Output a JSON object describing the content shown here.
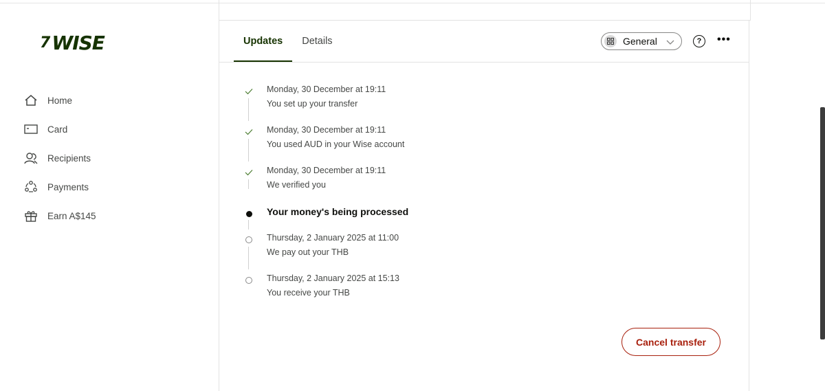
{
  "brand": {
    "mark": "7",
    "name": "WISE"
  },
  "sidebar": {
    "items": [
      {
        "label": "Home",
        "icon": "home-icon"
      },
      {
        "label": "Card",
        "icon": "card-icon"
      },
      {
        "label": "Recipients",
        "icon": "recipients-icon"
      },
      {
        "label": "Payments",
        "icon": "payments-icon"
      },
      {
        "label": "Earn A$145",
        "icon": "gift-icon"
      }
    ]
  },
  "tabs": [
    {
      "label": "Updates",
      "active": true
    },
    {
      "label": "Details",
      "active": false
    }
  ],
  "toolbar": {
    "account_selector": "General",
    "help_glyph": "?",
    "more_glyph": "•••"
  },
  "timeline": [
    {
      "status": "done",
      "date": "Monday, 30 December at 19:11",
      "text": "You set up your transfer"
    },
    {
      "status": "done",
      "date": "Monday, 30 December at 19:11",
      "text": "You used AUD in your Wise account"
    },
    {
      "status": "done",
      "date": "Monday, 30 December at 19:11",
      "text": "We verified you"
    },
    {
      "status": "current",
      "title": "Your money's being processed"
    },
    {
      "status": "pending",
      "date": "Thursday, 2 January 2025 at 11:00",
      "text": "We pay out your THB"
    },
    {
      "status": "pending",
      "date": "Thursday, 2 January 2025 at 15:13",
      "text": "You receive your THB"
    }
  ],
  "actions": {
    "cancel_label": "Cancel transfer"
  },
  "colors": {
    "brand_green": "#163300",
    "danger": "#a8200d",
    "check": "#37517e"
  }
}
